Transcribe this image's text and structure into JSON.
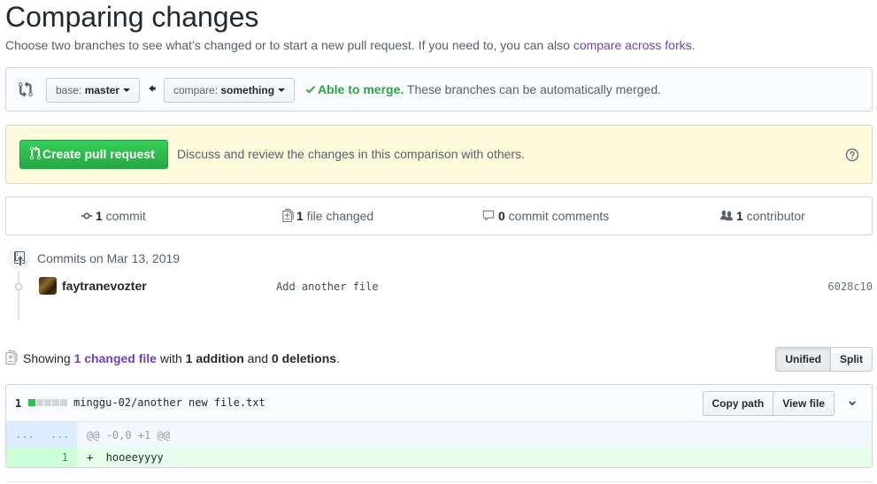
{
  "page": {
    "title": "Comparing changes",
    "subtitle_prefix": "Choose two branches to see what’s changed or to start a new pull request. If you need to, you can also ",
    "subtitle_link": "compare across forks",
    "subtitle_suffix": "."
  },
  "range": {
    "base_label": "base:",
    "base_value": "master",
    "compare_label": "compare:",
    "compare_value": "something",
    "merge_ok": "Able to merge.",
    "merge_text": " These branches can be automatically merged."
  },
  "pull_request": {
    "button_label": "Create pull request",
    "description": "Discuss and review the changes in this comparison with others."
  },
  "stats": {
    "commits_count": "1",
    "commits_label": " commit",
    "files_count": "1",
    "files_label": " file changed",
    "comments_count": "0",
    "comments_label": " commit comments",
    "contributors_count": "1",
    "contributors_label": " contributor"
  },
  "commits": {
    "date_header": "Commits on Mar 13, 2019",
    "items": [
      {
        "author": "faytranevozter",
        "message": "Add another file",
        "sha": "6028c10"
      }
    ]
  },
  "summary": {
    "showing": "Showing ",
    "changed_files": "1 changed file",
    "with": " with ",
    "additions": "1 addition",
    "and": " and ",
    "deletions": "0 deletions",
    "end": "."
  },
  "view_toggle": {
    "unified": "Unified",
    "split": "Split"
  },
  "diff": {
    "count": "1",
    "file_path": "minggu-02/another new file.txt",
    "copy_path": "Copy path",
    "view_file": "View file",
    "hunk_left": "...",
    "hunk_right": "...",
    "hunk_header": "@@ -0,0 +1 @@",
    "lines": [
      {
        "new_num": "1",
        "code": "+  hooeeyyyy"
      }
    ]
  },
  "colors": {
    "link": "#0366d6",
    "visited": "#6f42c1",
    "success": "#28a745",
    "pr_bg": "#fffbdd",
    "addition_bg": "#e6ffed"
  },
  "icons": [
    "git-compare-icon",
    "arrow-left-icon",
    "check-icon",
    "git-pull-request-icon",
    "question-icon",
    "git-commit-icon",
    "file-diff-icon",
    "comment-icon",
    "people-icon",
    "chevron-down-icon"
  ]
}
